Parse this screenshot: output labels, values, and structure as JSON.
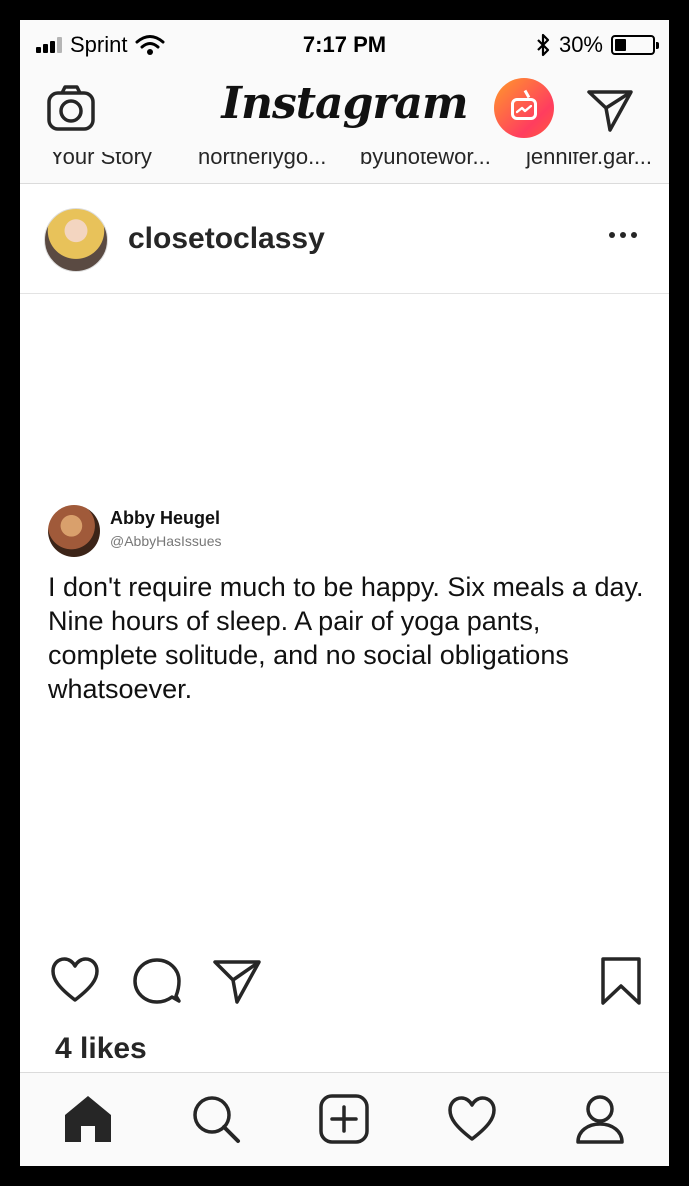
{
  "status_bar": {
    "carrier": "Sprint",
    "time": "7:17 PM",
    "battery_percent_label": "30%",
    "battery_level": 0.3,
    "bluetooth_icon": "bluetooth-icon",
    "wifi_icon": "wifi-icon"
  },
  "top_nav": {
    "logo": "Instagram",
    "camera_icon": "camera-icon",
    "igtv_icon": "igtv-icon",
    "direct_icon": "paper-plane-icon"
  },
  "stories": [
    "Your Story",
    "northerlygo...",
    "byunotewor...",
    "jennifer.gar..."
  ],
  "post": {
    "username": "closetoclassy",
    "tweet": {
      "name": "Abby Heugel",
      "handle": "@AbbyHasIssues",
      "text": "I don't require much to be happy. Six meals a day. Nine hours of sleep. A pair of yoga pants, complete solitude, and no social obligations whatsoever."
    },
    "likes": "4 likes"
  },
  "colors": {
    "igtv_gradient_start": "#ff9a2a",
    "igtv_gradient_end": "#ff3d5f",
    "text": "#262626",
    "divider": "#dbdbdb"
  }
}
